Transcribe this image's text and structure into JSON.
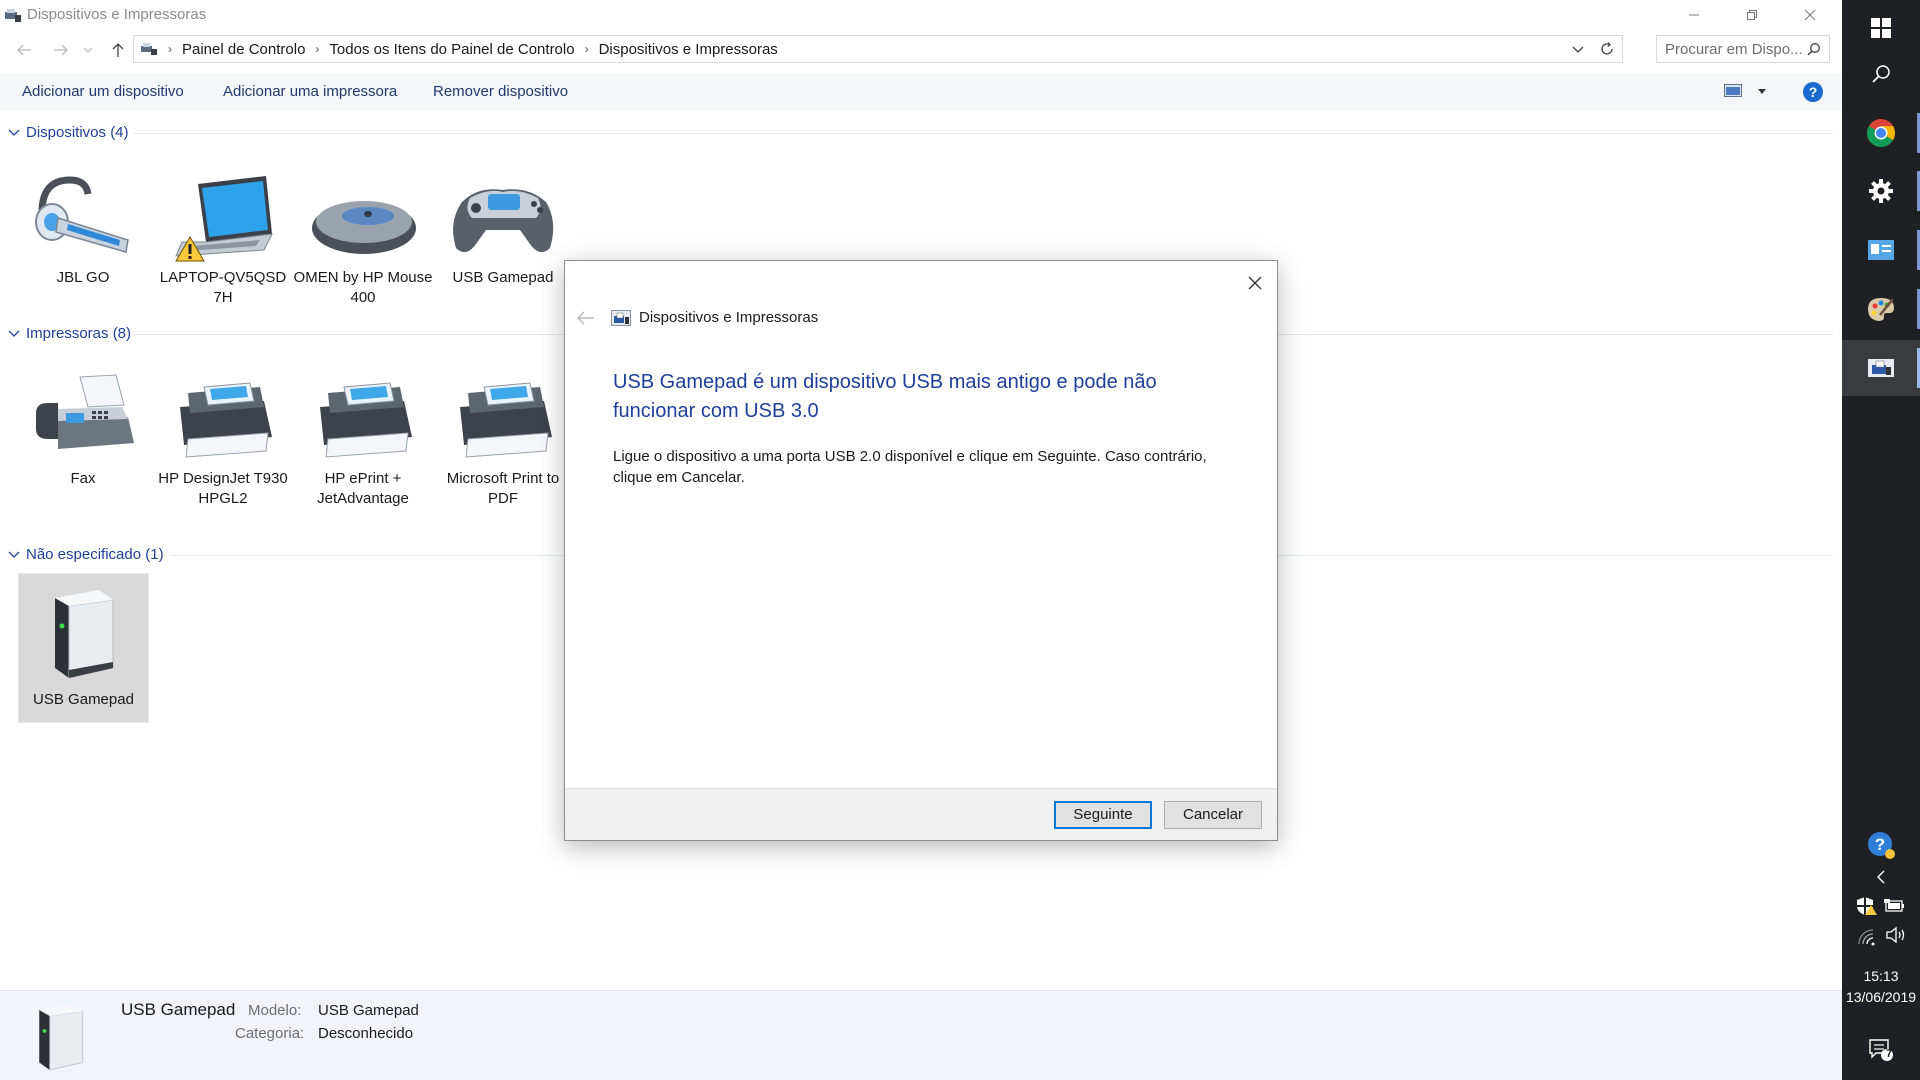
{
  "window": {
    "title": "Dispositivos e Impressoras"
  },
  "address": {
    "crumbs": [
      "Painel de Controlo",
      "Todos os Itens do Painel de Controlo",
      "Dispositivos e Impressoras"
    ],
    "search_placeholder": "Procurar em Dispo..."
  },
  "commands": {
    "add_device": "Adicionar um dispositivo",
    "add_printer": "Adicionar uma impressora",
    "remove_device": "Remover dispositivo"
  },
  "groups": {
    "devices": {
      "header": "Dispositivos (4)",
      "items": [
        {
          "label": "JBL GO"
        },
        {
          "label": "LAPTOP-QV5QSD 7H"
        },
        {
          "label": "OMEN by HP Mouse 400"
        },
        {
          "label": "USB Gamepad"
        }
      ]
    },
    "printers": {
      "header": "Impressoras (8)",
      "items": [
        {
          "label": "Fax"
        },
        {
          "label": "HP DesignJet T930 HPGL2"
        },
        {
          "label": "HP ePrint + JetAdvantage"
        },
        {
          "label": "Microsoft Print to PDF"
        }
      ]
    },
    "unspecified": {
      "header": "Não especificado (1)",
      "items": [
        {
          "label": "USB Gamepad"
        }
      ]
    }
  },
  "details": {
    "name": "USB Gamepad",
    "model_label": "Modelo:",
    "model_value": "USB Gamepad",
    "category_label": "Categoria:",
    "category_value": "Desconhecido"
  },
  "dialog": {
    "title": "Dispositivos e Impressoras",
    "heading": "USB Gamepad é um dispositivo USB mais antigo e pode não funcionar com USB 3.0",
    "body": "Ligue o dispositivo a uma porta USB 2.0 disponível e clique em Seguinte. Caso contrário, clique em Cancelar.",
    "next_button": "Seguinte",
    "cancel_button": "Cancelar"
  },
  "taskbar": {
    "time": "15:13",
    "date": "13/06/2019",
    "notification_count": "7"
  },
  "colors": {
    "accent": "#0078d7",
    "link_blue": "#1e3f9a",
    "taskbar": "#1f2023"
  }
}
